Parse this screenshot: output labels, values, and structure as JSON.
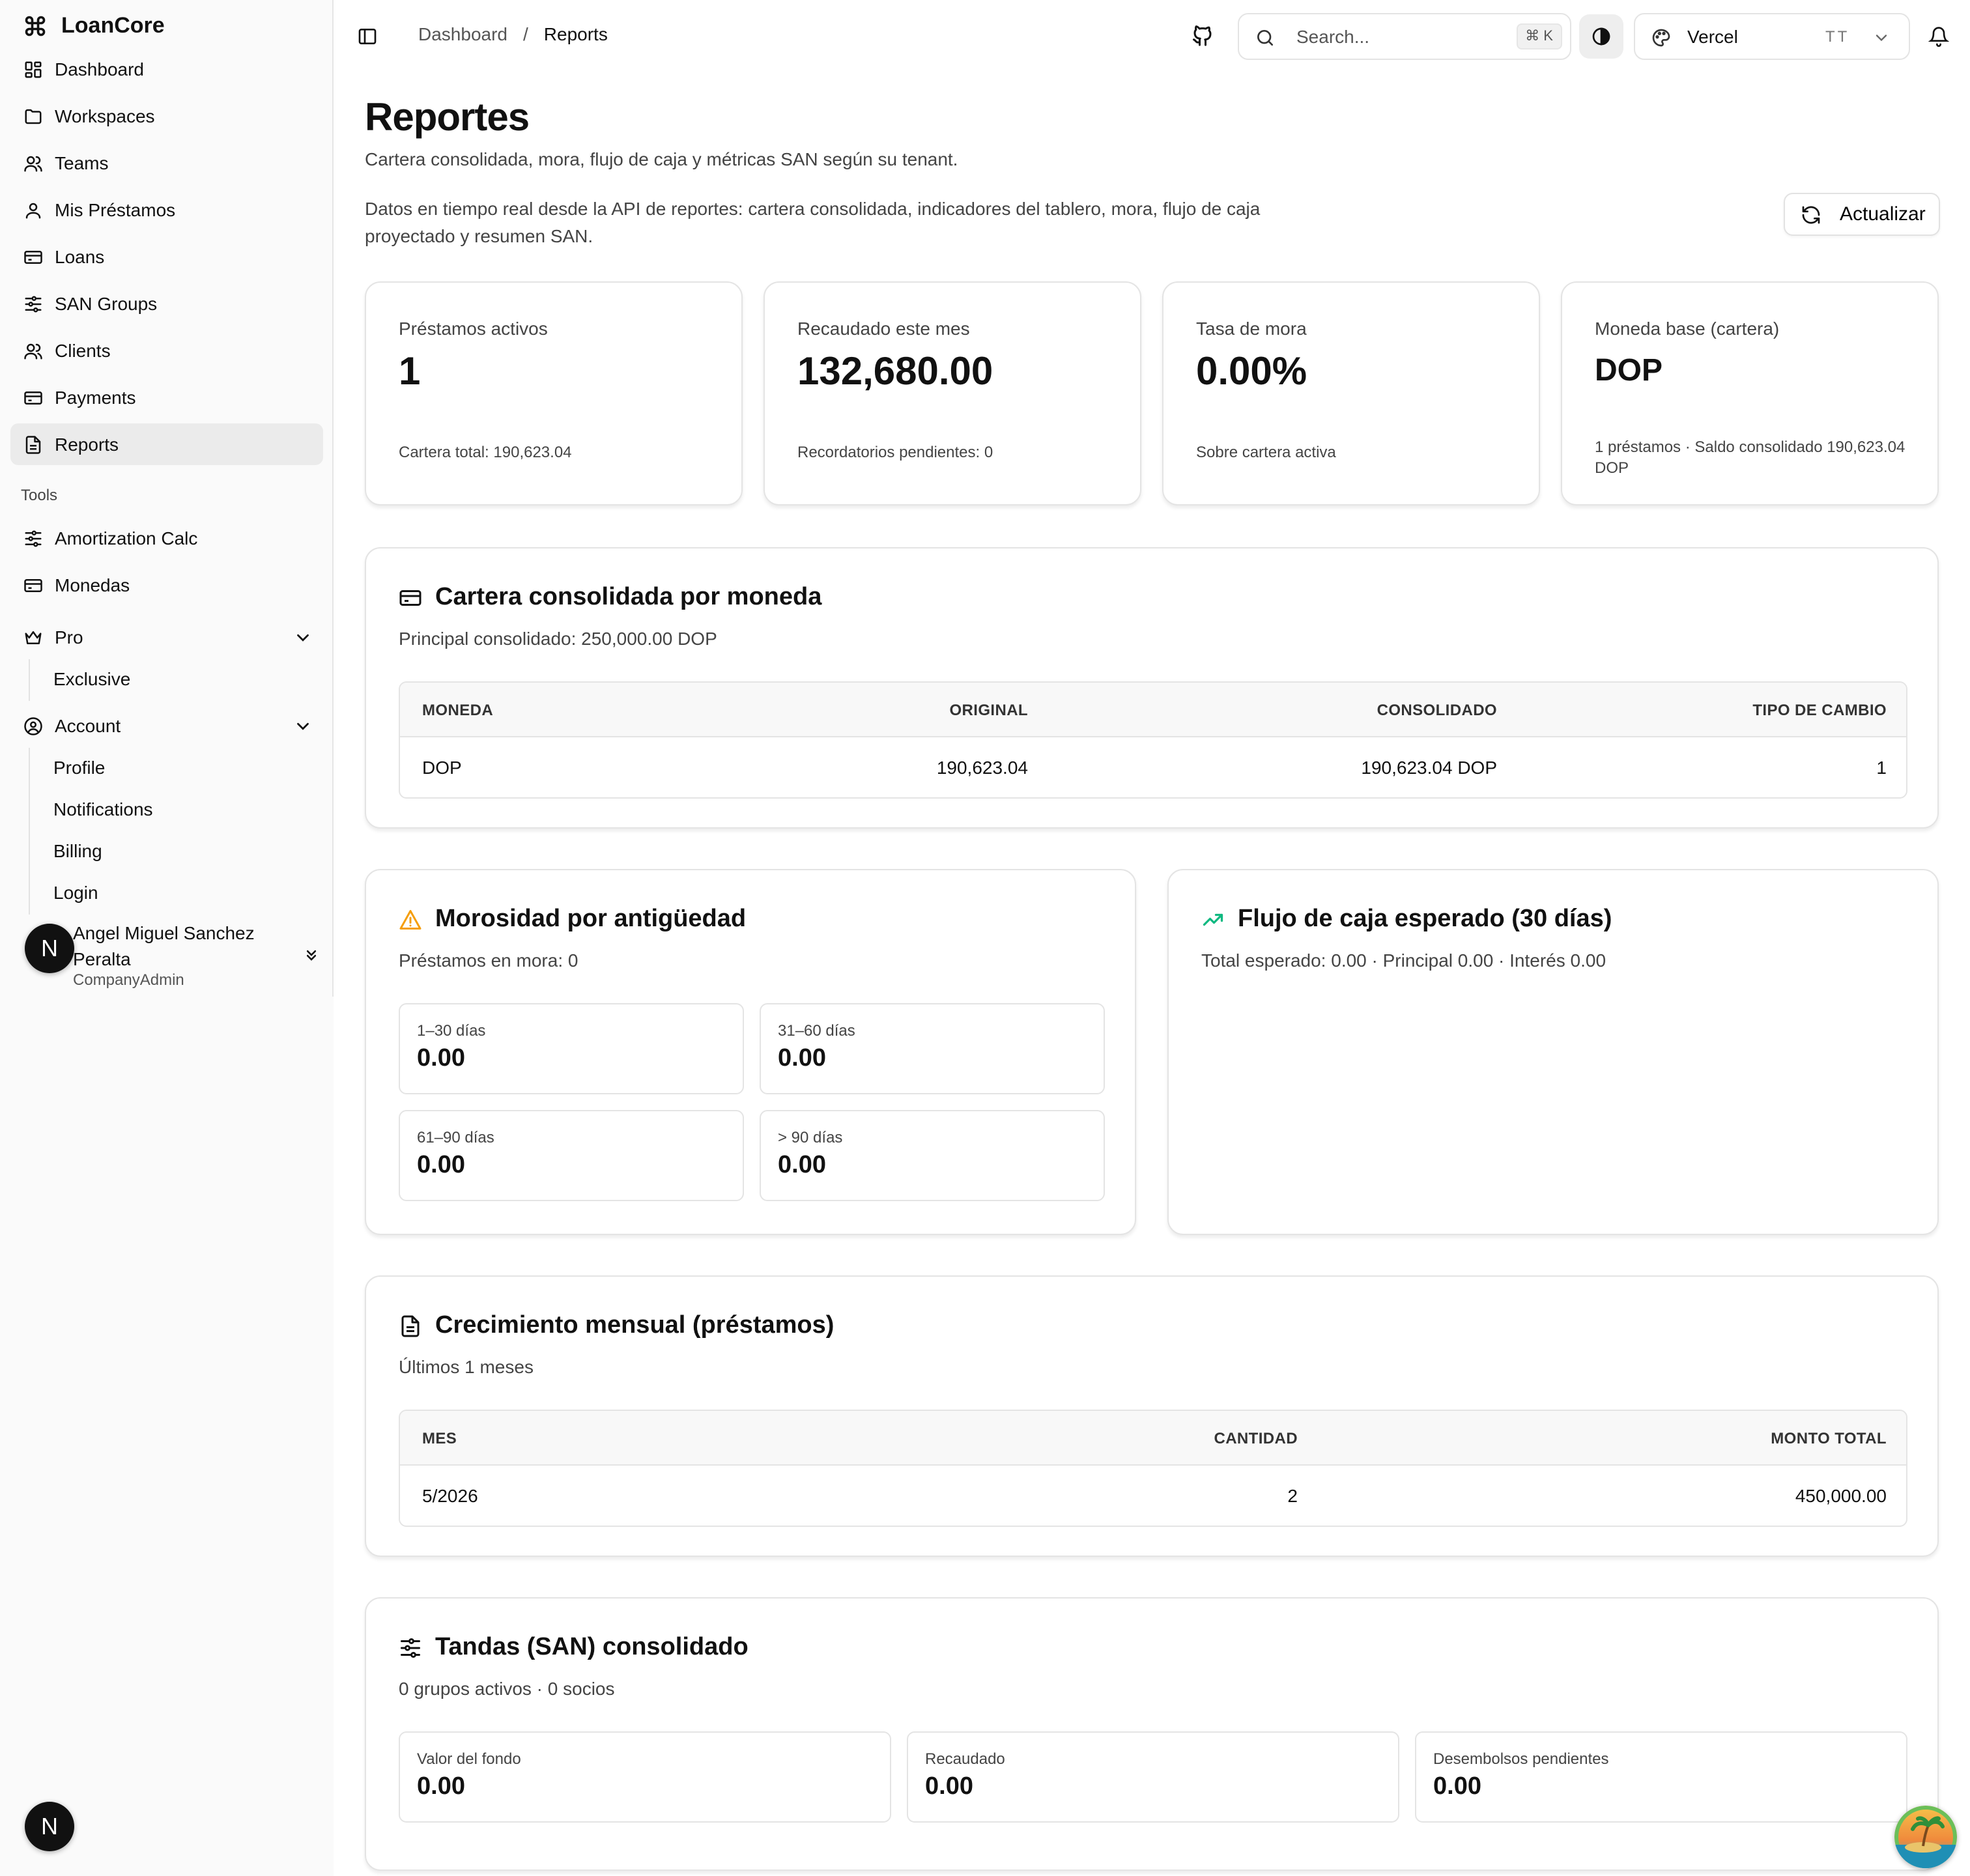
{
  "app": {
    "name": "LoanCore"
  },
  "sidebar": {
    "items": [
      {
        "label": "Dashboard"
      },
      {
        "label": "Workspaces"
      },
      {
        "label": "Teams"
      },
      {
        "label": "Mis Préstamos"
      },
      {
        "label": "Loans"
      },
      {
        "label": "SAN Groups"
      },
      {
        "label": "Clients"
      },
      {
        "label": "Payments"
      },
      {
        "label": "Reports",
        "active": true
      }
    ],
    "tools_label": "Tools",
    "tools": [
      {
        "label": "Amortization Calc"
      },
      {
        "label": "Monedas"
      }
    ],
    "pro": {
      "label": "Pro",
      "children": [
        "Exclusive"
      ]
    },
    "account": {
      "label": "Account",
      "children": [
        "Profile",
        "Notifications",
        "Billing",
        "Login"
      ]
    },
    "user": {
      "initial": "N",
      "name": "Angel Miguel Sanchez Peralta",
      "role": "CompanyAdmin"
    }
  },
  "header": {
    "breadcrumb": [
      "Dashboard",
      "Reports"
    ],
    "separator": "/",
    "search_placeholder": "Search...",
    "search_shortcut": "⌘ K",
    "team": "Vercel",
    "team_initials": "TT"
  },
  "page": {
    "title": "Reportes",
    "subtitle": "Cartera consolidada, mora, flujo de caja y métricas SAN según su tenant.",
    "description": "Datos en tiempo real desde la API de reportes: cartera consolidada, indicadores del tablero, mora, flujo de caja proyectado y resumen SAN.",
    "refresh_label": "Actualizar"
  },
  "stats": [
    {
      "label": "Préstamos activos",
      "value": "1",
      "foot": "Cartera total: 190,623.04"
    },
    {
      "label": "Recaudado este mes",
      "value": "132,680.00",
      "foot": "Recordatorios pendientes: 0"
    },
    {
      "label": "Tasa de mora",
      "value": "0.00%",
      "foot": "Sobre cartera activa"
    },
    {
      "label": "Moneda base (cartera)",
      "value": "DOP",
      "foot": "1 préstamos · Saldo consolidado 190,623.04 DOP"
    }
  ],
  "portfolio": {
    "title": "Cartera consolidada por moneda",
    "subtitle": "Principal consolidado: 250,000.00 DOP",
    "columns": [
      "MONEDA",
      "ORIGINAL",
      "CONSOLIDADO",
      "TIPO DE CAMBIO"
    ],
    "rows": [
      [
        "DOP",
        "190,623.04",
        "190,623.04 DOP",
        "1"
      ]
    ]
  },
  "delinquency": {
    "title": "Morosidad por antigüedad",
    "subtitle": "Préstamos en mora: 0",
    "buckets": [
      {
        "label": "1–30 días",
        "value": "0.00"
      },
      {
        "label": "31–60 días",
        "value": "0.00"
      },
      {
        "label": "61–90 días",
        "value": "0.00"
      },
      {
        "label": "> 90 días",
        "value": "0.00"
      }
    ]
  },
  "cashflow": {
    "title": "Flujo de caja esperado (30 días)",
    "subtitle": "Total esperado: 0.00 · Principal 0.00 · Interés 0.00"
  },
  "growth": {
    "title": "Crecimiento mensual (préstamos)",
    "subtitle": "Últimos 1 meses",
    "columns": [
      "MES",
      "CANTIDAD",
      "MONTO TOTAL"
    ],
    "rows": [
      [
        "5/2026",
        "2",
        "450,000.00"
      ]
    ]
  },
  "san": {
    "title": "Tandas (SAN) consolidado",
    "subtitle": "0 grupos activos · 0 socios",
    "boxes": [
      {
        "label": "Valor del fondo",
        "value": "0.00"
      },
      {
        "label": "Recaudado",
        "value": "0.00"
      },
      {
        "label": "Desembolsos pendientes",
        "value": "0.00"
      }
    ]
  },
  "floating": {
    "initial": "N"
  },
  "colors": {
    "warning": "#f59e0b",
    "trend": "#10b981",
    "active_bg": "#ebebeb"
  }
}
